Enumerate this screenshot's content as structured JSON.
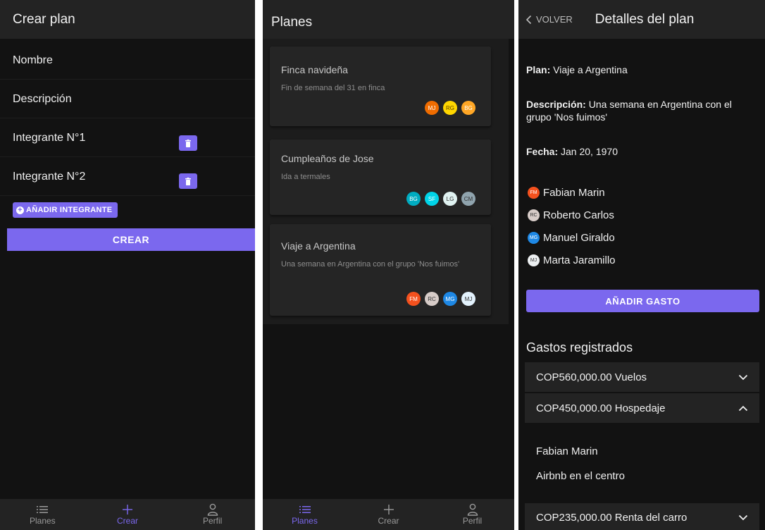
{
  "crear": {
    "title": "Crear plan",
    "fields": [
      "Nombre",
      "Descripción"
    ],
    "members": [
      "Integrante N°1",
      "Integrante N°2"
    ],
    "add_member_label": "AÑADIR INTEGRANTE",
    "submit_label": "CREAR",
    "nav": [
      "Planes",
      "Crear",
      "Perfil"
    ]
  },
  "planes": {
    "title": "Planes",
    "cards": [
      {
        "title": "Finca navideña",
        "desc": "Fin de semana del 31 en finca",
        "avatars": [
          {
            "initials": "MJ",
            "color": "#ef6c00"
          },
          {
            "initials": "RG",
            "color": "#ffd600"
          },
          {
            "initials": "BG",
            "color": "#ffa726"
          }
        ]
      },
      {
        "title": "Cumpleaños de Jose",
        "desc": "Ida a termales",
        "avatars": [
          {
            "initials": "BG",
            "color": "#00acc1"
          },
          {
            "initials": "SF",
            "color": "#00d4e8"
          },
          {
            "initials": "LG",
            "color": "#e0f2f1"
          },
          {
            "initials": "CM",
            "color": "#90a4ae"
          }
        ]
      },
      {
        "title": "Viaje a Argentina",
        "desc": "Una semana en Argentina con el grupo 'Nos fuimos'",
        "avatars": [
          {
            "initials": "FM",
            "color": "#f4511e"
          },
          {
            "initials": "RC",
            "color": "#d7ccc8"
          },
          {
            "initials": "MG",
            "color": "#1e88e5"
          },
          {
            "initials": "MJ",
            "color": "#e3f2fd"
          }
        ]
      }
    ],
    "nav": [
      "Planes",
      "Crear",
      "Perfil"
    ]
  },
  "detalle": {
    "back_label": "VOLVER",
    "title": "Detalles del plan",
    "plan_label": "Plan:",
    "plan_value": "Viaje a Argentina",
    "desc_label": "Descripción:",
    "desc_value": "Una semana en Argentina con el grupo 'Nos fuimos'",
    "date_label": "Fecha:",
    "date_value": "Jan 20, 1970",
    "members": [
      {
        "name": "Fabian Marin",
        "initials": "FM",
        "color": "#f4511e"
      },
      {
        "name": "Roberto Carlos",
        "initials": "RC",
        "color": "#d7ccc8"
      },
      {
        "name": "Manuel Giraldo",
        "initials": "MG",
        "color": "#1e88e5"
      },
      {
        "name": "Marta Jaramillo",
        "initials": "MJ",
        "color": "#eceff1"
      }
    ],
    "add_expense_label": "AÑADIR GASTO",
    "expenses_title": "Gastos registrados",
    "expenses": [
      {
        "label": "COP560,000.00 Vuelos",
        "expanded": false
      },
      {
        "label": "COP450,000.00 Hospedaje",
        "expanded": true,
        "payer": "Fabian Marin",
        "detail": "Airbnb en el centro"
      },
      {
        "label": "COP235,000.00 Renta del carro",
        "expanded": false
      }
    ]
  },
  "colors": {
    "accent": "#7b68ee",
    "background": "#121212",
    "surface": "#232323"
  }
}
